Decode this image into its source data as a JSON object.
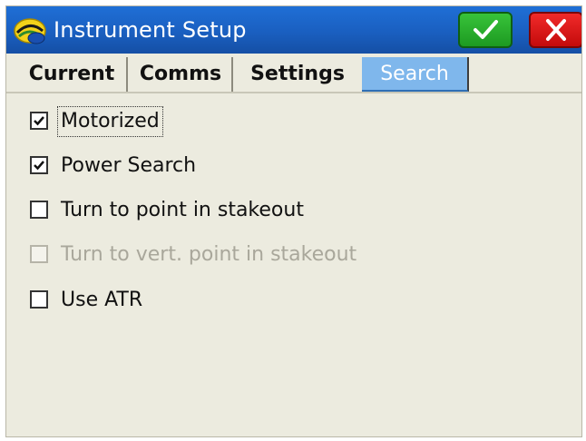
{
  "window": {
    "title": "Instrument Setup",
    "icons": {
      "app": "trimble-helmet-icon",
      "ok": "checkmark-icon",
      "close": "close-x-icon"
    },
    "colors": {
      "titlebar": "#1a5fc0",
      "ok": "#2aa82d",
      "close": "#d91414",
      "active_tab": "#7fb7ec"
    }
  },
  "tabs": [
    {
      "label": "Current",
      "active": false
    },
    {
      "label": "Comms",
      "active": false
    },
    {
      "label": "Settings",
      "active": false
    },
    {
      "label": "Search",
      "active": true
    }
  ],
  "options": [
    {
      "label": "Motorized",
      "checked": true,
      "enabled": true,
      "focused": true
    },
    {
      "label": "Power Search",
      "checked": true,
      "enabled": true,
      "focused": false
    },
    {
      "label": "Turn to point in stakeout",
      "checked": false,
      "enabled": true,
      "focused": false
    },
    {
      "label": "Turn to vert. point in stakeout",
      "checked": false,
      "enabled": false,
      "focused": false
    },
    {
      "label": "Use ATR",
      "checked": false,
      "enabled": true,
      "focused": false
    }
  ]
}
